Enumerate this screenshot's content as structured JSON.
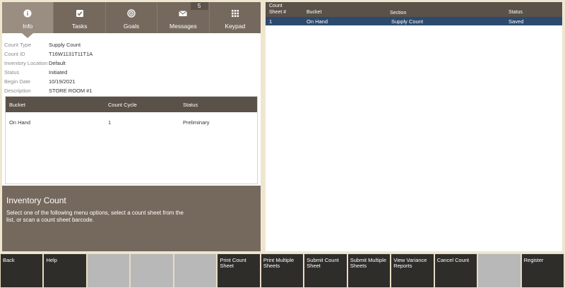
{
  "tabs": [
    {
      "label": "Info",
      "icon": "info-icon"
    },
    {
      "label": "Tasks",
      "icon": "checkbox-icon"
    },
    {
      "label": "Goals",
      "icon": "target-icon"
    },
    {
      "label": "Messages",
      "icon": "envelope-icon",
      "badge": "5"
    },
    {
      "label": "Keypad",
      "icon": "keypad-icon"
    }
  ],
  "info": [
    {
      "label": "Count Type",
      "value": "Supply Count"
    },
    {
      "label": "Count ID",
      "value": "T16W1131T11T1A"
    },
    {
      "label": "Inventory Location",
      "value": "Default"
    },
    {
      "label": "Status",
      "value": "Initiated"
    },
    {
      "label": "Begin Date",
      "value": "10/19/2021"
    },
    {
      "label": "Description",
      "value": "STORE ROOM #1"
    }
  ],
  "bucket_table": {
    "headers": [
      "Bucket",
      "Count Cycle",
      "Status"
    ],
    "rows": [
      [
        "On Hand",
        "1",
        "Preliminary"
      ]
    ]
  },
  "instructions": {
    "title": "Inventory Count",
    "text": "Select one of the following menu options, select a count sheet from the list, or scan a count sheet barcode."
  },
  "sheet_table": {
    "headers": {
      "sheet_line1": "Count",
      "sheet_line2": "Sheet #",
      "bucket": "Bucket",
      "section": "Section",
      "status": "Status"
    },
    "rows": [
      {
        "sheet": "1",
        "bucket": "On Hand",
        "section": "Supply Count",
        "status": "Saved"
      }
    ]
  },
  "toolbar": [
    {
      "label": "Back",
      "enabled": true
    },
    {
      "label": "Help",
      "enabled": true
    },
    {
      "label": "",
      "enabled": false
    },
    {
      "label": "",
      "enabled": false
    },
    {
      "label": "",
      "enabled": false
    },
    {
      "label": "Print Count Sheet",
      "enabled": true
    },
    {
      "label": "Print Multiple Sheets",
      "enabled": true
    },
    {
      "label": "Submit Count Sheet",
      "enabled": true
    },
    {
      "label": "Submit Multiple Sheets",
      "enabled": true
    },
    {
      "label": "View Variance Reports",
      "enabled": true
    },
    {
      "label": "Cancel Count",
      "enabled": true
    },
    {
      "label": "",
      "enabled": false
    },
    {
      "label": "Register",
      "enabled": true
    }
  ],
  "colors": {
    "background": "#efe6d0",
    "tab_bar": "#75695e",
    "tab_active": "#9a8e82",
    "table_header": "#5a5149",
    "selected_row": "#2c4a6d",
    "button": "#2f2d2a",
    "button_disabled": "#b8b8b8"
  }
}
